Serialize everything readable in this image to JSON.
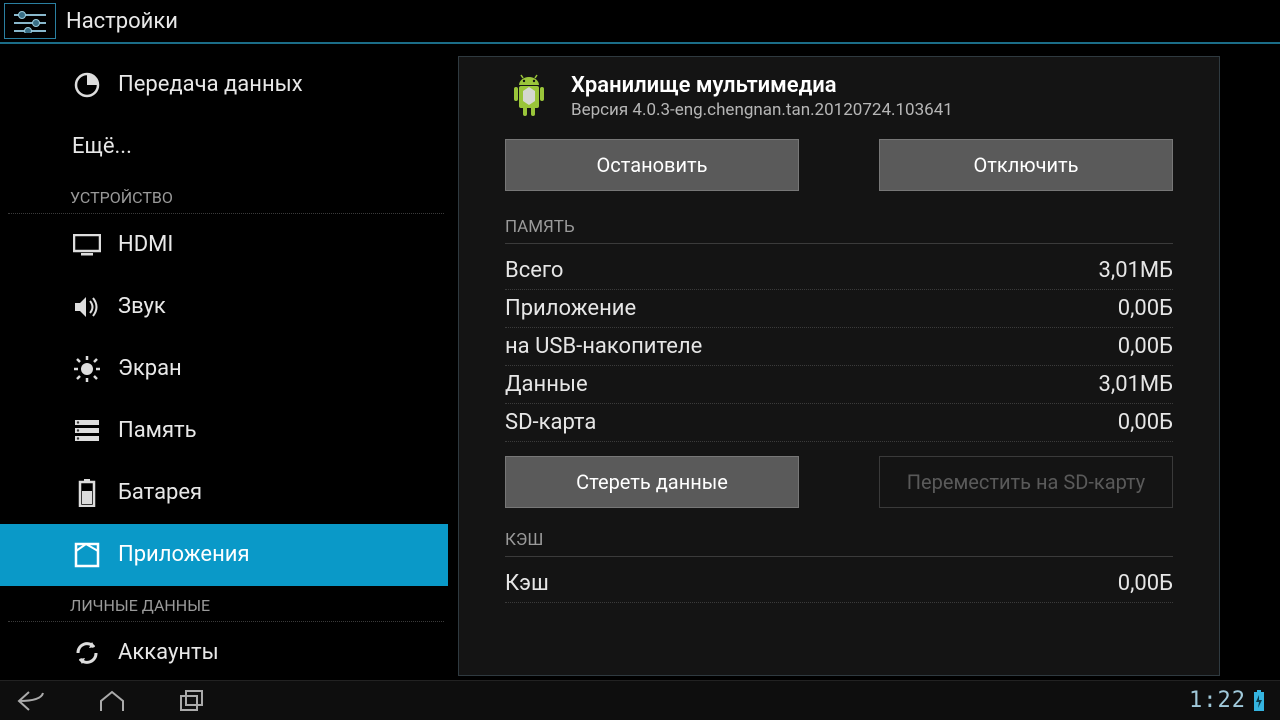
{
  "header": {
    "title": "Настройки"
  },
  "sidebar": {
    "items": [
      {
        "label": "Передача данных"
      },
      {
        "label": "Ещё..."
      }
    ],
    "section_device": "УСТРОЙСТВО",
    "device_items": [
      {
        "label": "HDMI"
      },
      {
        "label": "Звук"
      },
      {
        "label": "Экран"
      },
      {
        "label": "Память"
      },
      {
        "label": "Батарея"
      },
      {
        "label": "Приложения"
      }
    ],
    "section_personal": "ЛИЧНЫЕ ДАННЫЕ",
    "personal_items": [
      {
        "label": "Аккаунты"
      }
    ]
  },
  "app": {
    "title": "Хранилище мультимедиа",
    "version": "Версия 4.0.3-eng.chengnan.tan.20120724.103641",
    "stop_label": "Остановить",
    "disable_label": "Отключить",
    "memory_header": "ПАМЯТЬ",
    "rows": [
      {
        "k": "Всего",
        "v": "3,01МБ"
      },
      {
        "k": "Приложение",
        "v": "0,00Б"
      },
      {
        "k": "на USB-накопителе",
        "v": "0,00Б"
      },
      {
        "k": "Данные",
        "v": "3,01МБ"
      },
      {
        "k": "SD-карта",
        "v": "0,00Б"
      }
    ],
    "clear_data_label": "Стереть данные",
    "move_sd_label": "Переместить на SD-карту",
    "cache_header": "КЭШ",
    "cache_rows": [
      {
        "k": "Кэш",
        "v": "0,00Б"
      }
    ]
  },
  "status": {
    "clock": "1:22"
  }
}
